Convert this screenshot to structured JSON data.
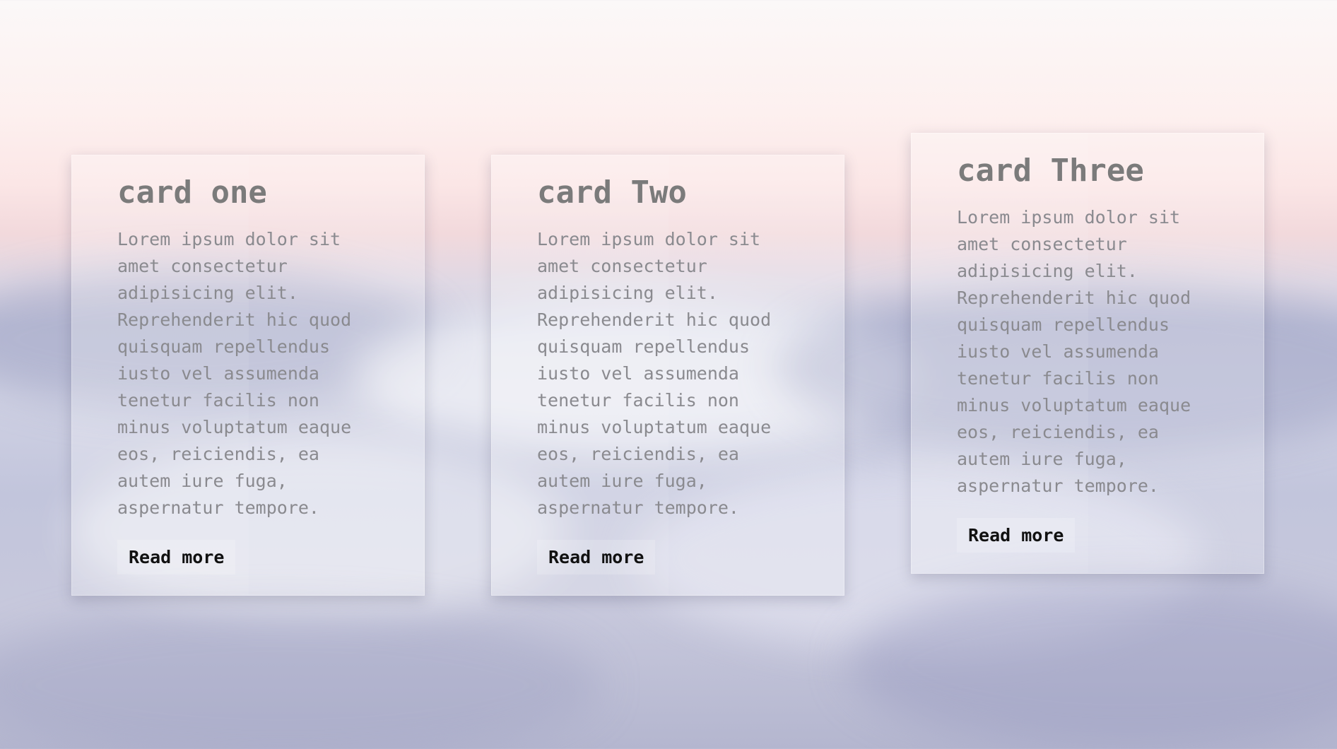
{
  "cards": [
    {
      "title": "card one",
      "body": "Lorem ipsum dolor sit amet consectetur adipisicing elit. Reprehenderit hic quod quisquam repellendus iusto vel assumenda tenetur facilis non minus voluptatum eaque eos, reiciendis, ea autem iure fuga, aspernatur tempore.",
      "button": "Read more"
    },
    {
      "title": "card Two",
      "body": "Lorem ipsum dolor sit amet consectetur adipisicing elit. Reprehenderit hic quod quisquam repellendus iusto vel assumenda tenetur facilis non minus voluptatum eaque eos, reiciendis, ea autem iure fuga, aspernatur tempore.",
      "button": "Read more"
    },
    {
      "title": "card Three",
      "body": "Lorem ipsum dolor sit amet consectetur adipisicing elit. Reprehenderit hic quod quisquam repellendus iusto vel assumenda tenetur facilis non minus voluptatum eaque eos, reiciendis, ea autem iure fuga, aspernatur tempore.",
      "button": "Read more"
    }
  ]
}
